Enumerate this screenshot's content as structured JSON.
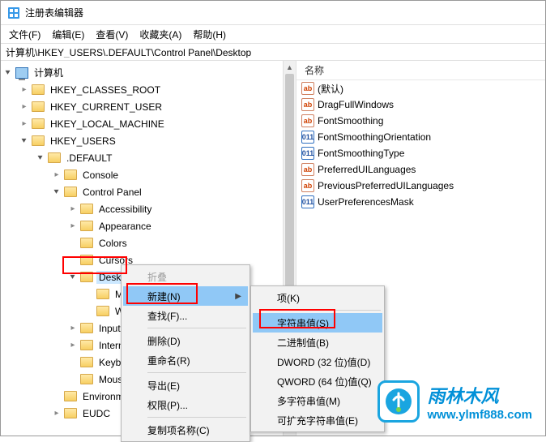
{
  "window": {
    "title": "注册表编辑器"
  },
  "menubar": {
    "file": "文件(F)",
    "edit": "编辑(E)",
    "view": "查看(V)",
    "favorites": "收藏夹(A)",
    "help": "帮助(H)"
  },
  "address": {
    "path": "计算机\\HKEY_USERS\\.DEFAULT\\Control Panel\\Desktop"
  },
  "tree": {
    "root": "计算机",
    "hkcr": "HKEY_CLASSES_ROOT",
    "hkcu": "HKEY_CURRENT_USER",
    "hklm": "HKEY_LOCAL_MACHINE",
    "hku": "HKEY_USERS",
    "default": ".DEFAULT",
    "console": "Console",
    "controlpanel": "Control Panel",
    "accessibility": "Accessibility",
    "appearance": "Appearance",
    "colors": "Colors",
    "cursors": "Cursors",
    "desktop": "Deskt",
    "m_partial": "M",
    "w_partial": "W",
    "input": "Input",
    "internf": "Interna",
    "keybo": "Keybo",
    "mous": "Mous",
    "environment": "Environm",
    "eudc": "EUDC"
  },
  "list_header": {
    "name": "名称"
  },
  "values": [
    {
      "icon": "ab",
      "name": "(默认)"
    },
    {
      "icon": "ab",
      "name": "DragFullWindows"
    },
    {
      "icon": "ab",
      "name": "FontSmoothing"
    },
    {
      "icon": "bin",
      "name": "FontSmoothingOrientation"
    },
    {
      "icon": "bin",
      "name": "FontSmoothingType"
    },
    {
      "icon": "ab",
      "name": "PreferredUILanguages"
    },
    {
      "icon": "ab",
      "name": "PreviousPreferredUILanguages"
    },
    {
      "icon": "bin",
      "name": "UserPreferencesMask"
    }
  ],
  "ctx1": {
    "collapse": "折叠",
    "new": "新建(N)",
    "find": "查找(F)...",
    "delete": "删除(D)",
    "rename": "重命名(R)",
    "export": "导出(E)",
    "perm": "权限(P)...",
    "copykey": "复制项名称(C)"
  },
  "ctx2": {
    "key": "项(K)",
    "string": "字符串值(S)",
    "binary": "二进制值(B)",
    "dword": "DWORD (32 位)值(D)",
    "qword": "QWORD (64 位)值(Q)",
    "multi": "多字符串值(M)",
    "expand": "可扩充字符串值(E)"
  },
  "watermark": {
    "name": "雨林木风",
    "url": "www.ylmf888.com"
  }
}
